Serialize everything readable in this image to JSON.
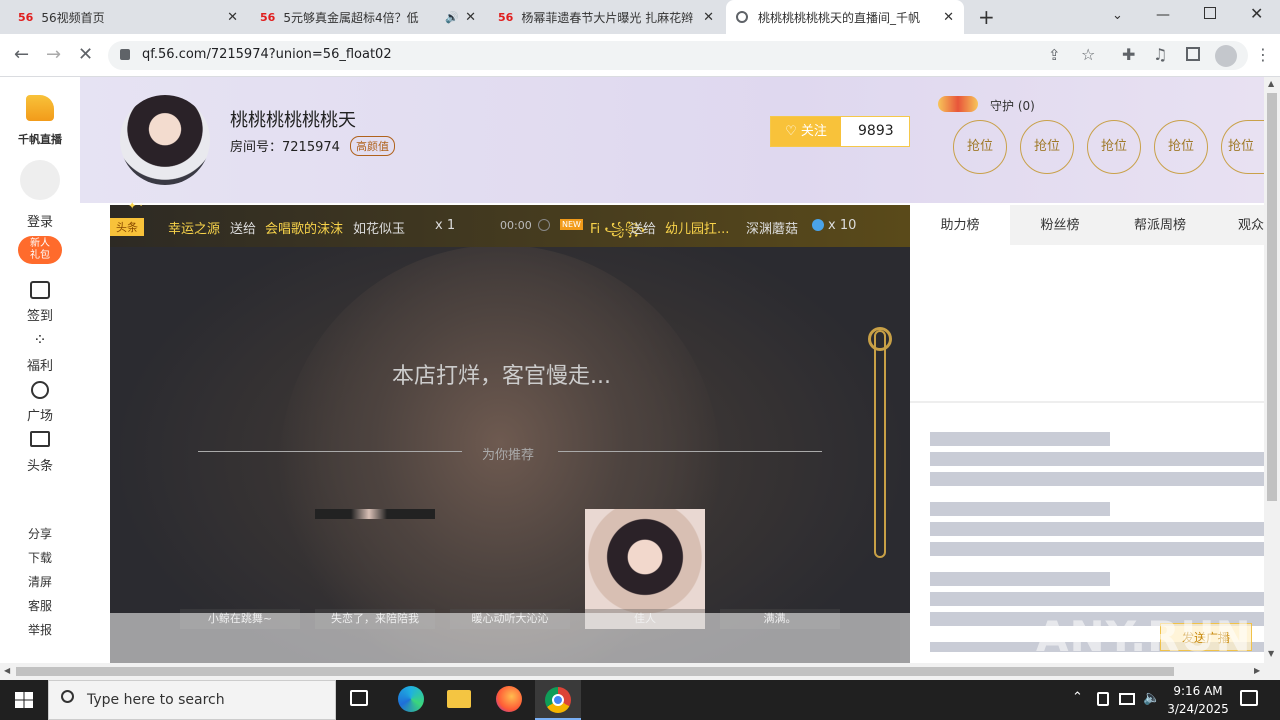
{
  "browser": {
    "tabs": [
      {
        "favicon": "56",
        "title": "56视频首页"
      },
      {
        "favicon": "56",
        "title": "5元够真金属超标4倍？低"
      },
      {
        "favicon": "56",
        "title": "杨幂菲遗春节大片曝光 扎麻花辫"
      },
      {
        "favicon": "globe-icon",
        "title": "桃桃桃桃桃桃天的直播间_千帆"
      }
    ],
    "new_tab": "+",
    "url": "qf.56.com/7215974?union=56_float02"
  },
  "sidebar": {
    "logo_text": "千帆直播",
    "login": "登录",
    "newbie_badge_line1": "新人",
    "newbie_badge_line2": "礼包",
    "items": [
      {
        "icon": "checkin-icon",
        "label": "签到"
      },
      {
        "icon": "welfare-icon",
        "label": "福利"
      },
      {
        "icon": "plaza-icon",
        "label": "广场"
      },
      {
        "icon": "headline-icon",
        "label": "头条"
      }
    ],
    "links": [
      "分享",
      "下载",
      "清屏",
      "客服",
      "举报"
    ]
  },
  "room": {
    "anchor_name": "桃桃桃桃桃桃天",
    "room_id_label": "房间号：7215974",
    "tag": "高颜值",
    "follow_label": "关注",
    "follow_count": "9893",
    "guard_label": "守护 (0)",
    "seat_label": "抢位",
    "seat_count": 5
  },
  "marquee": {
    "tag": "头条",
    "from1": "幸运之源",
    "sent1": "送给",
    "to1": "会唱歌的沫沫",
    "gift1": "如花似玉",
    "count1": "x 1",
    "time": "00:00",
    "new_badge": "NEW",
    "from2": "Fi ꧁꧂",
    "sent2": "送给",
    "to2": "幼儿园扛...",
    "gift2": "深渊蘑菇",
    "count2": "x 10"
  },
  "video": {
    "closed_text": "本店打烊，客官慢走...",
    "recommend_label": "为你推荐",
    "recommended": [
      "小鲸在跳舞~",
      "失恋了，来陪陪我",
      "暖心动听大沁沁",
      "佳人",
      "满满。"
    ]
  },
  "rightpanel": {
    "tabs": [
      "助力榜",
      "粉丝榜",
      "帮派周榜",
      "观众"
    ],
    "send_ad": "发送广播"
  },
  "taskbar": {
    "search_placeholder": "Type here to search",
    "time": "9:16 AM",
    "date": "3/24/2025"
  },
  "watermark": "ANY.RUN"
}
